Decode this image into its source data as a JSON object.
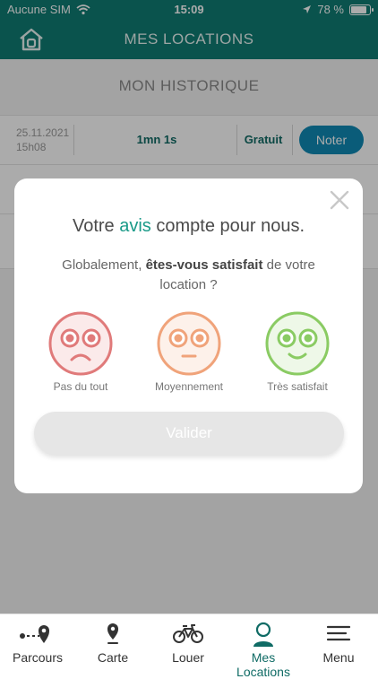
{
  "status_bar": {
    "carrier": "Aucune SIM",
    "time": "15:09",
    "battery": "78 %",
    "battery_level": 0.78
  },
  "header": {
    "title": "MES LOCATIONS"
  },
  "history": {
    "title": "MON HISTORIQUE",
    "rows": [
      {
        "date": "25.11.2021",
        "time": "15h08",
        "duration": "1mn 1s",
        "price": "Gratuit",
        "action": "Noter"
      }
    ]
  },
  "modal": {
    "headline_prefix": "Votre ",
    "headline_accent": "avis",
    "headline_suffix": " compte pour nous.",
    "question_prefix": "Globalement, ",
    "question_bold": "êtes-vous satisfait",
    "question_suffix": " de votre location ?",
    "ratings": [
      {
        "label": "Pas du tout",
        "color": "#e07a7a",
        "icon": "sad-face-icon"
      },
      {
        "label": "Moyennement",
        "color": "#f0a37a",
        "icon": "neutral-face-icon"
      },
      {
        "label": "Très satisfait",
        "color": "#8acb63",
        "icon": "happy-face-icon"
      }
    ],
    "submit_label": "Valider"
  },
  "tabbar": {
    "items": [
      {
        "label": "Parcours",
        "icon": "route-icon"
      },
      {
        "label": "Carte",
        "icon": "map-pin-icon"
      },
      {
        "label": "Louer",
        "icon": "bike-icon"
      },
      {
        "label": "Mes Locations",
        "icon": "user-icon",
        "active": true
      },
      {
        "label": "Menu",
        "icon": "menu-icon"
      }
    ]
  },
  "colors": {
    "primary": "#0f7d73",
    "accent": "#1a9a88",
    "button_blue": "#0f8ab5"
  }
}
